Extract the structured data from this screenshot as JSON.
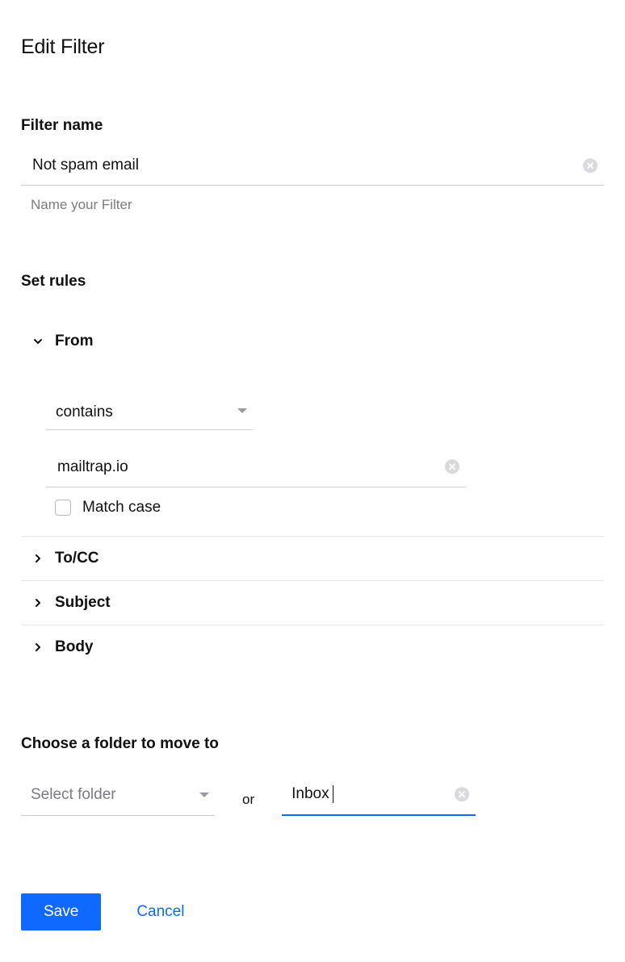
{
  "title": "Edit Filter",
  "filterName": {
    "label": "Filter name",
    "value": "Not spam email",
    "helper": "Name your Filter"
  },
  "rules": {
    "heading": "Set rules",
    "from": {
      "label": "From",
      "operator": "contains",
      "value": "mailtrap.io",
      "matchCaseLabel": "Match case"
    },
    "toCc": {
      "label": "To/CC"
    },
    "subject": {
      "label": "Subject"
    },
    "body": {
      "label": "Body"
    }
  },
  "folder": {
    "heading": "Choose a folder to move to",
    "selectPlaceholder": "Select folder",
    "or": "or",
    "inputValue": "Inbox"
  },
  "actions": {
    "save": "Save",
    "cancel": "Cancel"
  }
}
